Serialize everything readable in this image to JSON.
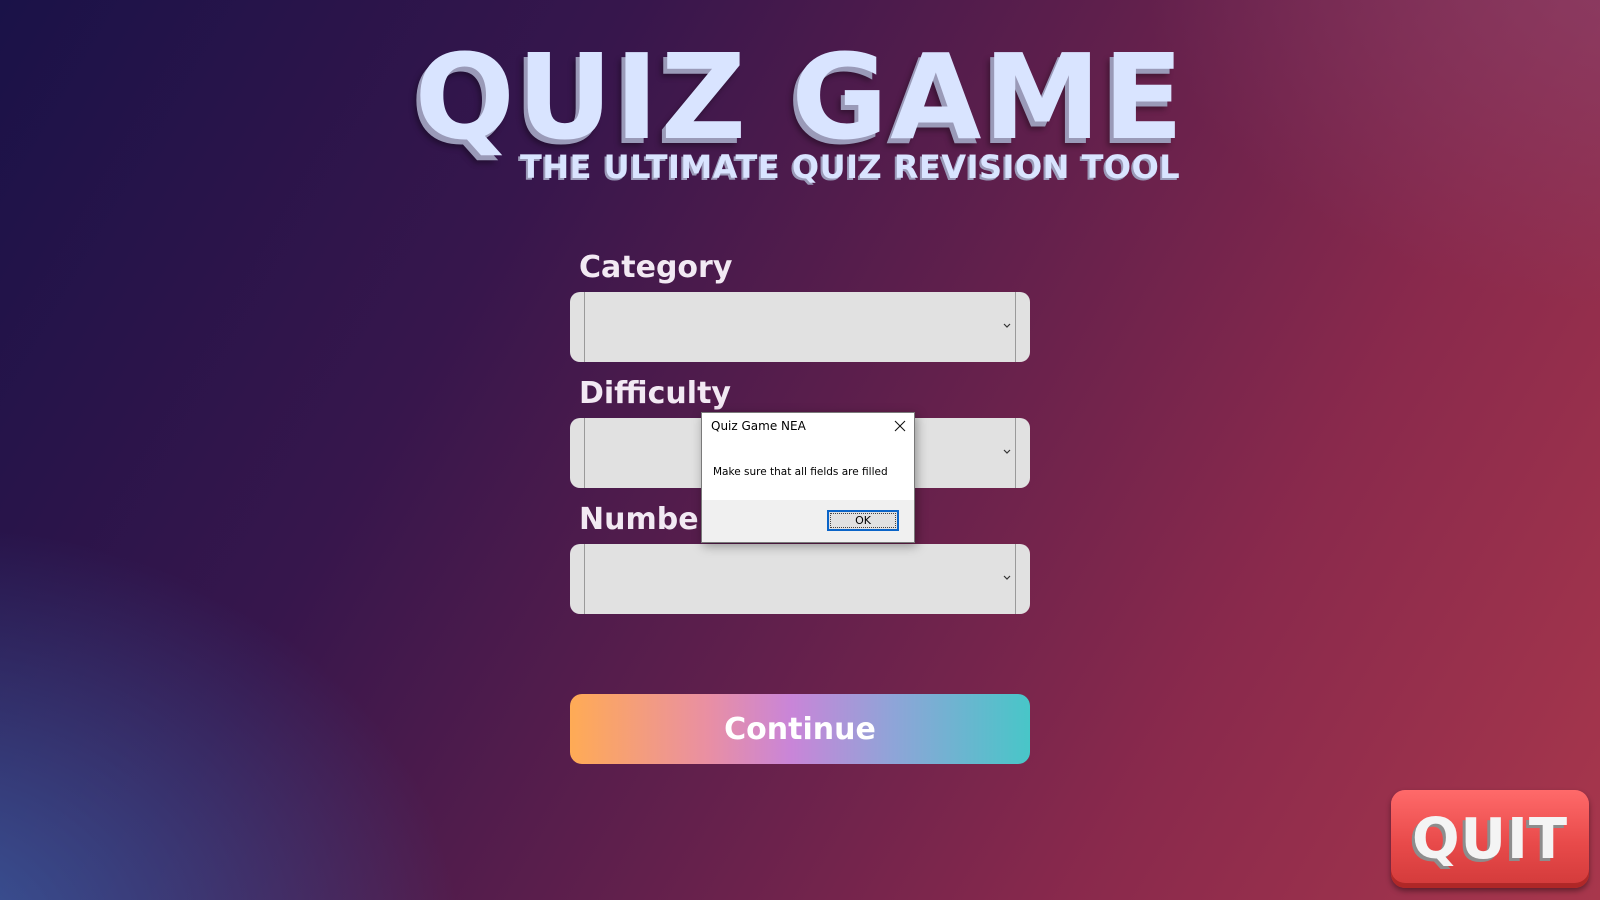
{
  "app": {
    "title": "QUIZ GAME",
    "subtitle": "THE ULTIMATE QUIZ REVISION TOOL"
  },
  "form": {
    "category": {
      "label": "Category",
      "value": ""
    },
    "difficulty": {
      "label": "Difficulty",
      "value": ""
    },
    "number": {
      "label": "Number",
      "value": ""
    }
  },
  "buttons": {
    "continue_label": "Continue",
    "quit_label": "QUIT"
  },
  "dialog": {
    "title": "Quiz Game NEA",
    "message": "Make sure that all fields are filled",
    "ok_label": "OK"
  },
  "icons": {
    "dropdown": "chevron-down-icon",
    "close": "close-icon"
  },
  "colors": {
    "title_text": "#d9e4ff",
    "quit_button": "#e84a4a",
    "dialog_focus": "#0a64c8"
  }
}
